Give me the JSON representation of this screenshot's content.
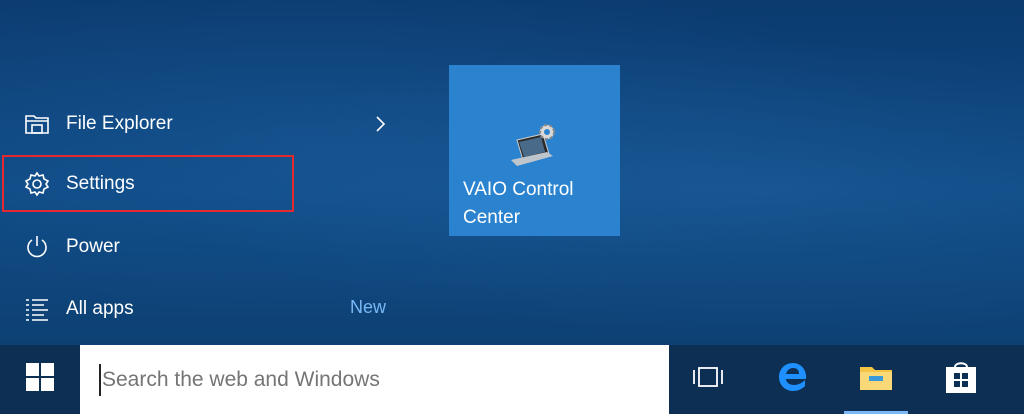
{
  "start_menu": {
    "items": [
      {
        "label": "File Explorer",
        "icon": "folder-icon"
      },
      {
        "label": "Settings",
        "icon": "gear-icon"
      },
      {
        "label": "Power",
        "icon": "power-icon"
      },
      {
        "label": "All apps",
        "icon": "list-icon"
      }
    ],
    "all_apps_badge": "New"
  },
  "tiles": [
    {
      "label": "VAIO Control Center",
      "icon": "laptop-gear-icon",
      "color": "#2b83d0"
    }
  ],
  "taskbar": {
    "search_placeholder": "Search the web and Windows",
    "pinned": [
      "task-view-icon",
      "edge-icon",
      "file-explorer-icon",
      "store-icon"
    ]
  },
  "colors": {
    "highlight": "#e52a2f",
    "accent": "#79b8f5",
    "taskbar": "#0c2f53"
  }
}
